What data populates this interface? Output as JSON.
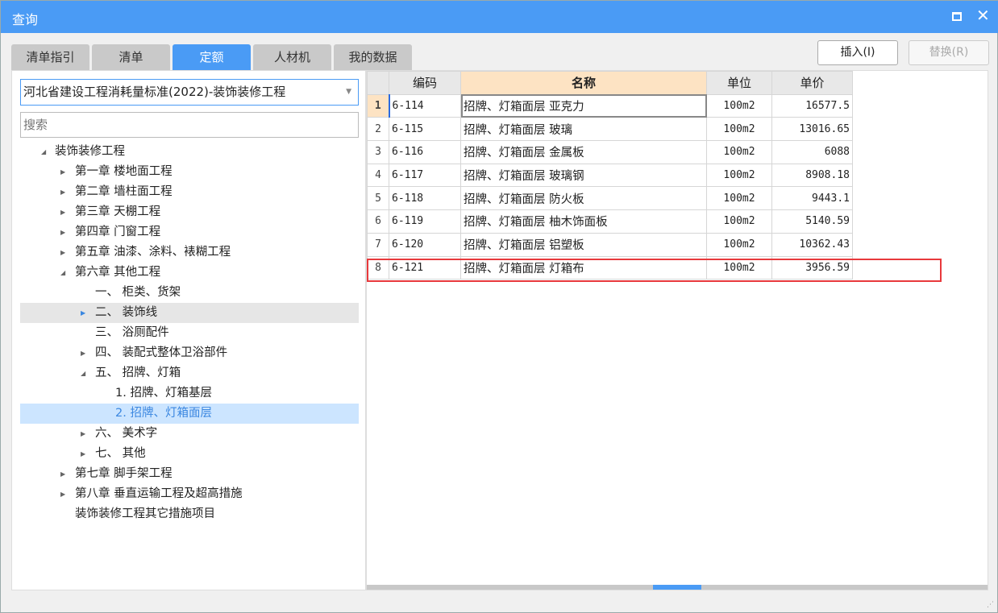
{
  "window": {
    "title": "查询"
  },
  "tabs": [
    {
      "label": "清单指引"
    },
    {
      "label": "清单"
    },
    {
      "label": "定额",
      "active": true
    },
    {
      "label": "人材机"
    },
    {
      "label": "我的数据"
    }
  ],
  "buttons": {
    "insert": "插入(I)",
    "replace": "替换(R)"
  },
  "library": {
    "selected": "河北省建设工程消耗量标准(2022)-装饰装修工程"
  },
  "search": {
    "placeholder": "搜索",
    "value": ""
  },
  "tree": [
    {
      "label": "装饰装修工程",
      "level": 0,
      "state": "expanded"
    },
    {
      "label": "第一章 楼地面工程",
      "level": 1,
      "state": "collapsed"
    },
    {
      "label": "第二章 墙柱面工程",
      "level": 1,
      "state": "collapsed"
    },
    {
      "label": "第三章 天棚工程",
      "level": 1,
      "state": "collapsed"
    },
    {
      "label": "第四章 门窗工程",
      "level": 1,
      "state": "collapsed"
    },
    {
      "label": "第五章 油漆、涂料、裱糊工程",
      "level": 1,
      "state": "collapsed"
    },
    {
      "label": "第六章 其他工程",
      "level": 1,
      "state": "expanded"
    },
    {
      "label": "一、 柜类、货架",
      "level": 2,
      "state": "leaf"
    },
    {
      "label": "二、 装饰线",
      "level": 2,
      "state": "collapsed",
      "hover": true
    },
    {
      "label": "三、 浴厕配件",
      "level": 2,
      "state": "leaf"
    },
    {
      "label": "四、 装配式整体卫浴部件",
      "level": 2,
      "state": "collapsed"
    },
    {
      "label": "五、 招牌、灯箱",
      "level": 2,
      "state": "expanded"
    },
    {
      "label": "1. 招牌、灯箱基层",
      "level": 3,
      "state": "leaf"
    },
    {
      "label": "2. 招牌、灯箱面层",
      "level": 3,
      "state": "leaf",
      "selected": true
    },
    {
      "label": "六、 美术字",
      "level": 2,
      "state": "collapsed"
    },
    {
      "label": "七、 其他",
      "level": 2,
      "state": "collapsed"
    },
    {
      "label": "第七章 脚手架工程",
      "level": 1,
      "state": "collapsed"
    },
    {
      "label": "第八章 垂直运输工程及超高措施",
      "level": 1,
      "state": "collapsed"
    },
    {
      "label": "装饰装修工程其它措施项目",
      "level": 1,
      "state": "leaf"
    }
  ],
  "table": {
    "headers": {
      "code": "编码",
      "name": "名称",
      "unit": "单位",
      "price": "单价"
    },
    "rows": [
      {
        "no": "1",
        "code": "6-114",
        "name": "招牌、灯箱面层 亚克力",
        "unit": "100m2",
        "price": "16577.5"
      },
      {
        "no": "2",
        "code": "6-115",
        "name": "招牌、灯箱面层 玻璃",
        "unit": "100m2",
        "price": "13016.65"
      },
      {
        "no": "3",
        "code": "6-116",
        "name": "招牌、灯箱面层 金属板",
        "unit": "100m2",
        "price": "6088"
      },
      {
        "no": "4",
        "code": "6-117",
        "name": "招牌、灯箱面层 玻璃钢",
        "unit": "100m2",
        "price": "8908.18"
      },
      {
        "no": "5",
        "code": "6-118",
        "name": "招牌、灯箱面层 防火板",
        "unit": "100m2",
        "price": "9443.1"
      },
      {
        "no": "6",
        "code": "6-119",
        "name": "招牌、灯箱面层 柚木饰面板",
        "unit": "100m2",
        "price": "5140.59"
      },
      {
        "no": "7",
        "code": "6-120",
        "name": "招牌、灯箱面层 铝塑板",
        "unit": "100m2",
        "price": "10362.43"
      },
      {
        "no": "8",
        "code": "6-121",
        "name": "招牌、灯箱面层 灯箱布",
        "unit": "100m2",
        "price": "3956.59"
      }
    ],
    "current_row": 1,
    "highlighted_row": 8
  },
  "colors": {
    "accent": "#4a9bf5",
    "highlight": "#e8393c",
    "selection": "#cce5ff"
  }
}
